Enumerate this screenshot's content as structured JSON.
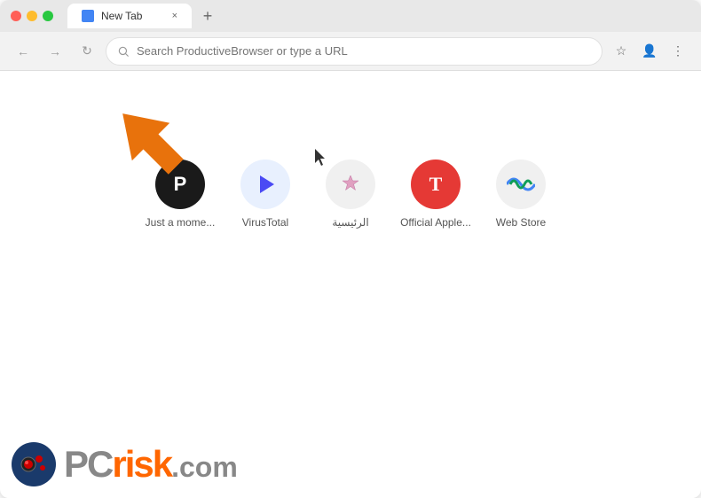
{
  "browser": {
    "tab_title": "New Tab",
    "tab_close": "×",
    "new_tab_icon": "+",
    "back_icon": "←",
    "forward_icon": "→",
    "reload_icon": "↻",
    "address_placeholder": "Search ProductiveBrowser or type a URL",
    "bookmark_icon": "☆",
    "account_icon": "👤",
    "menu_icon": "⋮"
  },
  "shortcuts": [
    {
      "id": "just-a-moment",
      "label": "Just a mome...",
      "bg_color": "#1a1a1a",
      "text_color": "#fff",
      "icon_text": "P"
    },
    {
      "id": "virustotal",
      "label": "VirusTotal",
      "bg_color": "#e8f0fe",
      "text_color": "#4285f4",
      "icon_text": "▷"
    },
    {
      "id": "arabic-site",
      "label": "الرئيسية",
      "bg_color": "#f0f0f0",
      "text_color": "#555",
      "icon_text": "✦"
    },
    {
      "id": "official-apple",
      "label": "Official Apple...",
      "bg_color": "#e53935",
      "text_color": "#fff",
      "icon_text": "T"
    },
    {
      "id": "web-store",
      "label": "Web Store",
      "bg_color": "#f0f0f0",
      "text_color": "#555",
      "icon_text": "🌈"
    }
  ],
  "watermark": {
    "pc_text": "PC",
    "risk_text": "risk",
    "dot_com": ".com"
  }
}
